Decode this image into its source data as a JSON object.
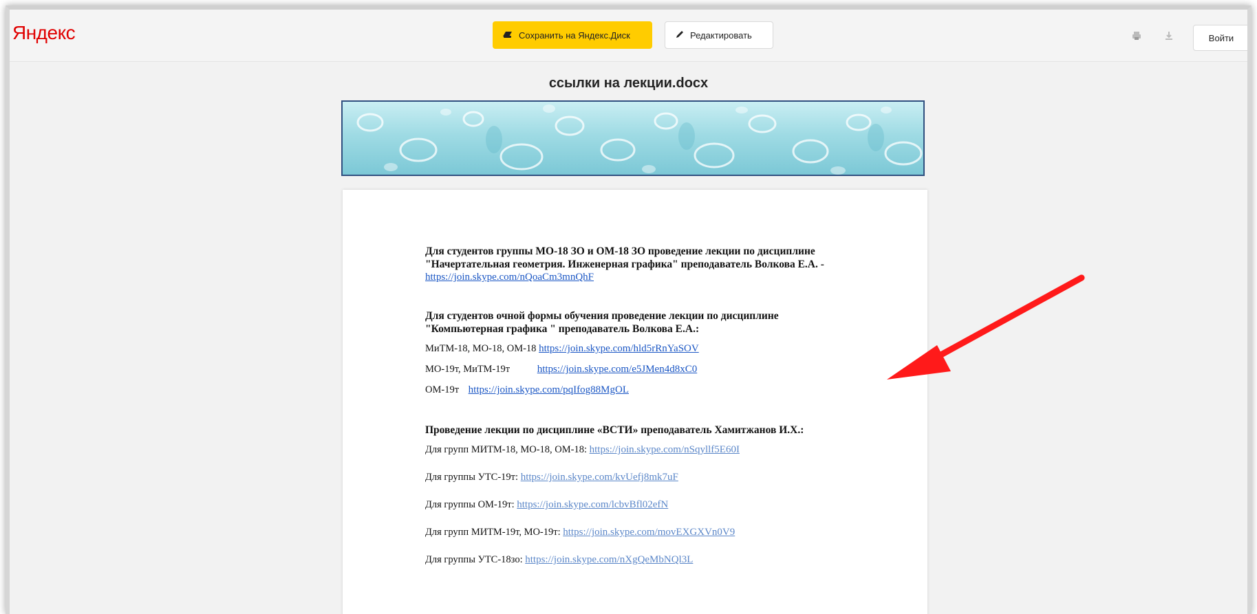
{
  "header": {
    "logo": "Яндекс",
    "save_button": "Сохранить на Яндекс.Диск",
    "edit_button": "Редактировать",
    "login_button": "Войти",
    "accent_color": "#ffcc00",
    "logo_color": "#e00000"
  },
  "document": {
    "title": "ссылки на лекции.docx",
    "section1": {
      "heading_line1": "Для студентов группы МО-18 ЗО и ОМ-18 ЗО проведение лекции по дисциплине",
      "heading_line2": "\"Начертательная геометрия. Инженерная графика\" преподаватель Волкова Е.А. -",
      "link": "https://join.skype.com/nQoaCm3mnQhF"
    },
    "section2": {
      "heading_line1": "Для студентов очной формы обучения проведение лекции по дисциплине",
      "heading_line2": "\"Компьютерная графика \" преподаватель Волкова Е.А.:",
      "rows": [
        {
          "label": "МиТМ-18, МО-18, ОМ-18",
          "link": "https://join.skype.com/hld5rRnYaSOV"
        },
        {
          "label": "МО-19т, МиТМ-19т",
          "link": "https://join.skype.com/e5JMen4d8xC0"
        },
        {
          "label": "ОМ-19т",
          "link": "https://join.skype.com/pqIfog88MgOL"
        }
      ]
    },
    "section3": {
      "heading": "Проведение лекции по дисциплине «ВСТИ» преподаватель Хамитжанов И.Х.:",
      "rows": [
        {
          "label": "Для групп МИТМ-18, МО-18, ОМ-18:",
          "link": "https://join.skype.com/nSqyllf5E60I"
        },
        {
          "label": "Для группы УТС-19т:",
          "link": "https://join.skype.com/kvUefj8mk7uF"
        },
        {
          "label": "Для группы ОМ-19т:",
          "link": "https://join.skype.com/lcbvBfl02efN"
        },
        {
          "label": "Для групп МИТМ-19т, МО-19т:",
          "link": "https://join.skype.com/movEXGXVn0V9"
        },
        {
          "label": "Для группы УТС-18зо:",
          "link": "https://join.skype.com/nXgQeMbNQl3L"
        }
      ]
    }
  },
  "icons": [
    "disk-icon",
    "pencil-icon",
    "print-icon",
    "download-icon",
    "arrow-icon"
  ],
  "arrow_color": "#ff1a1a"
}
